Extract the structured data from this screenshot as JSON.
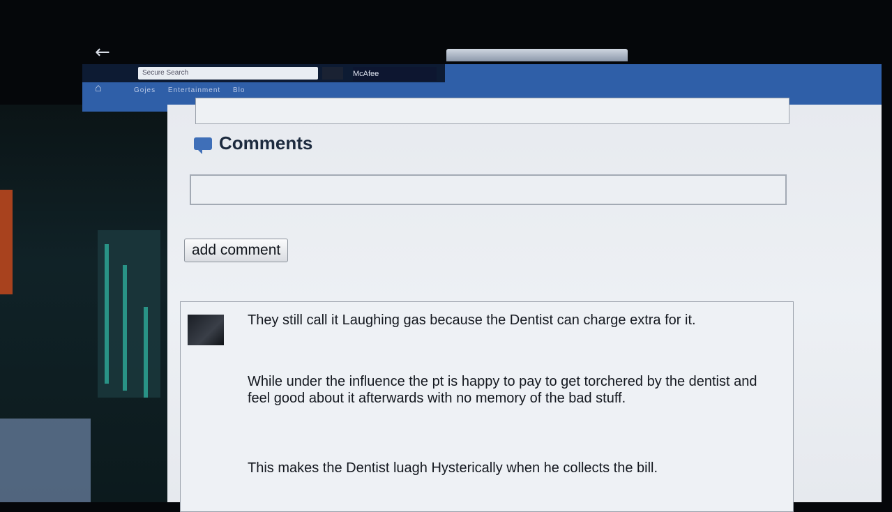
{
  "browser": {
    "search_placeholder": "Secure Search",
    "security_label": "McAfee",
    "bookmarks": [
      "Gojes",
      "Entertainment",
      "Blo"
    ]
  },
  "comments": {
    "title": "Comments",
    "input_value": "",
    "add_button_label": "add comment",
    "items": [
      {
        "paragraphs": [
          "They still call it Laughing gas because the Dentist can charge extra for it.",
          "While under the influence the pt is happy to pay to get torchered by the dentist and feel good about it afterwards with no memory of the bad stuff.",
          "This makes the Dentist luagh Hysterically when he collects the bill."
        ]
      }
    ]
  },
  "colors": {
    "toolbar_blue": "#2f5fa8",
    "page_background": "#e9ecf0",
    "accent_icon": "#3f6fb8"
  },
  "icons": {
    "back": "back-arrow-icon",
    "home": "home-icon",
    "comments": "speech-bubble-icon"
  }
}
